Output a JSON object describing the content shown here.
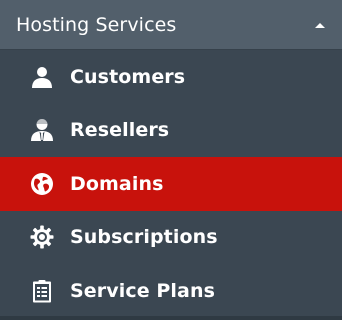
{
  "section": {
    "title": "Hosting Services",
    "collapse_icon": "caret-up-icon"
  },
  "items": [
    {
      "label": "Customers",
      "icon": "user-icon",
      "active": false
    },
    {
      "label": "Resellers",
      "icon": "reseller-icon",
      "active": false
    },
    {
      "label": "Domains",
      "icon": "globe-icon",
      "active": true
    },
    {
      "label": "Subscriptions",
      "icon": "gear-icon",
      "active": false
    },
    {
      "label": "Service Plans",
      "icon": "clipboard-icon",
      "active": false
    }
  ],
  "colors": {
    "header_bg": "#525f6b",
    "menu_bg": "#3b4752",
    "active_bg": "#c8120c",
    "text": "#ffffff"
  }
}
